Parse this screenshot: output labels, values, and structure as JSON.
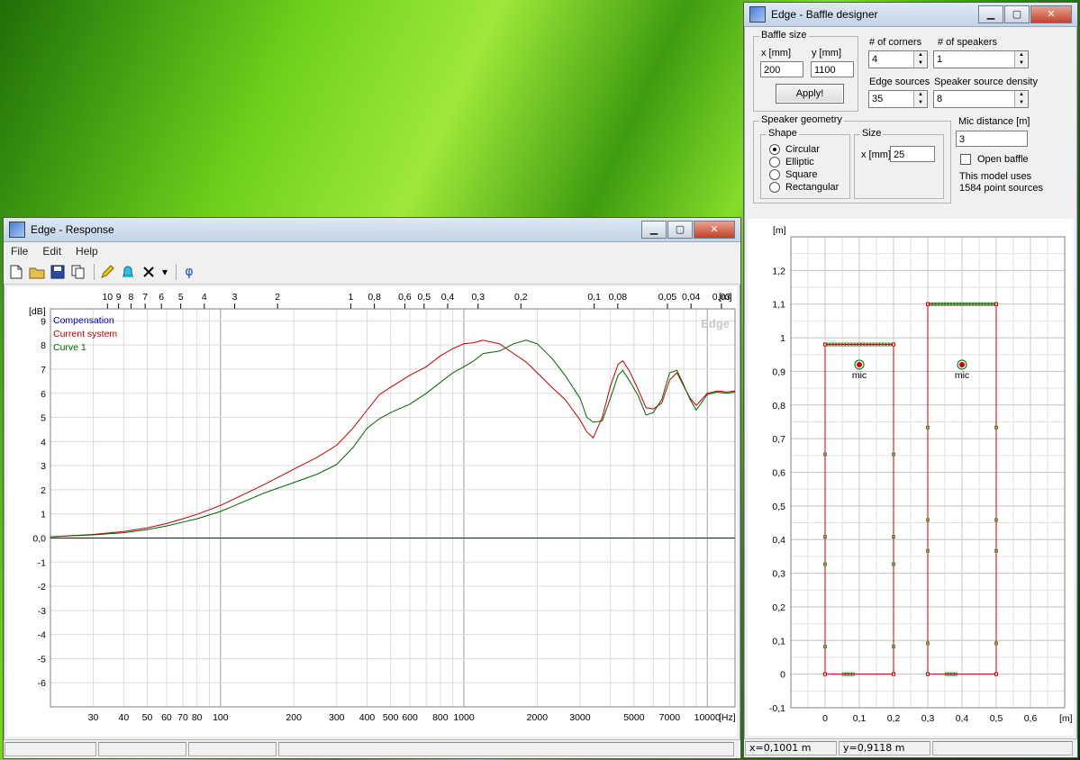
{
  "response_window": {
    "title": "Edge - Response",
    "menu": [
      "File",
      "Edit",
      "Help"
    ],
    "watermark": "Edge",
    "status": [
      "",
      "",
      "",
      ""
    ]
  },
  "baffle_window": {
    "title": "Edge - Baffle designer",
    "baffle_size_label": "Baffle size",
    "x_label": "x [mm]",
    "y_label": "y [mm]",
    "x_value": "200",
    "y_value": "1100",
    "apply_label": "Apply!",
    "corners_label": "# of corners",
    "corners_value": "4",
    "speakers_label": "# of speakers",
    "speakers_value": "1",
    "edge_sources_label": "Edge sources",
    "edge_sources_value": "35",
    "density_label": "Speaker source density",
    "density_value": "8",
    "geometry_label": "Speaker geometry",
    "shape_label": "Shape",
    "shapes": [
      "Circular",
      "Elliptic",
      "Square",
      "Rectangular"
    ],
    "selected_shape": 0,
    "size_label": "Size",
    "size_x_label": "x [mm]",
    "size_x_value": "25",
    "mic_distance_label": "Mic distance [m]",
    "mic_distance_value": "3",
    "open_baffle_label": "Open baffle",
    "model_info_1": "This model uses",
    "model_info_2": "1584 point sources",
    "status_x": "x=0,1001 m",
    "status_y": "y=0,9118 m"
  },
  "chart_data": [
    {
      "type": "line",
      "ylabel": "[dB]",
      "xlabel": "[Hz]",
      "top_axis_label": "[m]",
      "ylim": [
        -7,
        9.5
      ],
      "xlim": [
        20,
        13000
      ],
      "x_scale": "log",
      "grid": true,
      "legend_placement": "top-left",
      "x_ticks": [
        30,
        40,
        50,
        60,
        70,
        80,
        100,
        200,
        300,
        400,
        500,
        600,
        800,
        1000,
        2000,
        3000,
        5000,
        7000,
        10000
      ],
      "x_tick_labels": [
        "30",
        "40",
        "50",
        "60",
        "70",
        "80",
        "100",
        "200",
        "300",
        "400",
        "500",
        "600",
        "800",
        "1000",
        "2000",
        "3000",
        "5000",
        "7000",
        "10000"
      ],
      "top_ticks": [
        10,
        9,
        8,
        7,
        6,
        5,
        4,
        3,
        2,
        1,
        0.8,
        0.6,
        0.5,
        0.4,
        0.3,
        0.2,
        0.1,
        0.08,
        0.05,
        0.04,
        0.03
      ],
      "top_tick_labels": [
        "10",
        "9",
        "8",
        "7",
        "6",
        "5",
        "4",
        "3",
        "2",
        "1",
        "0,8",
        "0,6",
        "0,5",
        "0,4",
        "0,3",
        "0,2",
        "0,1",
        "0,08",
        "0,05",
        "0,04",
        "0,03"
      ],
      "y_ticks": [
        9,
        8,
        7,
        6,
        5,
        4,
        3,
        2,
        1,
        0,
        -1,
        -2,
        -3,
        -4,
        -5,
        -6
      ],
      "y_tick_labels": [
        "9",
        "8",
        "7",
        "6",
        "5",
        "4",
        "3",
        "2",
        "1",
        "0,0",
        "-1",
        "-2",
        "-3",
        "-4",
        "-5",
        "-6"
      ],
      "series": [
        {
          "name": "Compensation",
          "color": "#0000b0",
          "x": [
            20,
            13000
          ],
          "y": [
            0,
            0
          ]
        },
        {
          "name": "Current system",
          "color": "#c00000",
          "x": [
            20,
            30,
            40,
            50,
            60,
            70,
            80,
            100,
            150,
            200,
            250,
            300,
            350,
            400,
            450,
            500,
            600,
            700,
            800,
            900,
            1000,
            1100,
            1200,
            1400,
            1600,
            1800,
            2000,
            2300,
            2600,
            3000,
            3200,
            3400,
            3700,
            4000,
            4300,
            4500,
            4800,
            5200,
            5600,
            6000,
            6500,
            7000,
            7500,
            8000,
            8500,
            9000,
            10000,
            11000,
            12000,
            13000
          ],
          "y": [
            0.05,
            0.15,
            0.27,
            0.42,
            0.6,
            0.8,
            0.98,
            1.35,
            2.2,
            2.85,
            3.35,
            3.85,
            4.55,
            5.3,
            5.95,
            6.25,
            6.75,
            7.1,
            7.55,
            7.85,
            8.05,
            8.1,
            8.2,
            8.05,
            7.65,
            7.3,
            6.85,
            6.25,
            5.75,
            4.9,
            4.4,
            4.15,
            5.0,
            6.3,
            7.2,
            7.35,
            6.9,
            6.15,
            5.4,
            5.35,
            5.6,
            6.55,
            6.85,
            6.3,
            5.8,
            5.5,
            6.0,
            6.1,
            6.05,
            6.1
          ]
        },
        {
          "name": "Curve 1",
          "color": "#006400",
          "x": [
            20,
            30,
            40,
            50,
            60,
            70,
            80,
            100,
            150,
            200,
            250,
            300,
            350,
            400,
            450,
            500,
            600,
            700,
            800,
            900,
            1000,
            1100,
            1200,
            1400,
            1600,
            1800,
            2000,
            2300,
            2600,
            3000,
            3200,
            3400,
            3700,
            4000,
            4300,
            4500,
            4800,
            5200,
            5600,
            6000,
            6500,
            7000,
            7500,
            8000,
            8500,
            9000,
            10000,
            11000,
            12000,
            13000
          ],
          "y": [
            0.05,
            0.13,
            0.22,
            0.35,
            0.5,
            0.66,
            0.8,
            1.1,
            1.85,
            2.3,
            2.65,
            3.05,
            3.75,
            4.55,
            4.95,
            5.2,
            5.55,
            6.0,
            6.45,
            6.85,
            7.1,
            7.35,
            7.65,
            7.75,
            8.05,
            8.2,
            8.05,
            7.45,
            6.75,
            5.8,
            5.0,
            4.8,
            4.85,
            5.8,
            6.75,
            6.95,
            6.5,
            5.9,
            5.1,
            5.2,
            5.75,
            6.85,
            6.95,
            6.35,
            5.75,
            5.3,
            5.95,
            6.05,
            6.0,
            6.05
          ]
        }
      ]
    },
    {
      "type": "scatter",
      "ylabel": "[m]",
      "xlabel": "[m]",
      "xlim": [
        -0.1,
        0.7
      ],
      "ylim": [
        -0.1,
        1.3
      ],
      "grid": true,
      "x_ticks": [
        0,
        0.1,
        0.2,
        0.3,
        0.4,
        0.5,
        0.6
      ],
      "x_tick_labels": [
        "0",
        "0,1",
        "0,2",
        "0,3",
        "0,4",
        "0,5",
        "0,6"
      ],
      "y_ticks": [
        -0.1,
        0,
        0.1,
        0.2,
        0.3,
        0.4,
        0.5,
        0.6,
        0.7,
        0.8,
        0.9,
        1,
        1.1,
        1.2
      ],
      "y_tick_labels": [
        "-0,1",
        "0",
        "0,1",
        "0,2",
        "0,3",
        "0,4",
        "0,5",
        "0,6",
        "0,7",
        "0,8",
        "0,9",
        "1",
        "1,1",
        "1,2"
      ],
      "outline_color": "#cc0000",
      "point_color": "#1a7a1a",
      "mic_label": "mic",
      "baffles": [
        {
          "outline": [
            [
              0,
              0
            ],
            [
              0.2,
              0
            ],
            [
              0.2,
              0.98
            ],
            [
              0,
              0.98
            ]
          ],
          "mic": [
            0.1,
            0.92
          ],
          "speaker": [
            0.1,
            0.92
          ]
        },
        {
          "outline": [
            [
              0.3,
              0
            ],
            [
              0.5,
              0
            ],
            [
              0.5,
              1.1
            ],
            [
              0.3,
              1.1
            ]
          ],
          "mic": [
            0.4,
            0.92
          ],
          "speaker": [
            0.4,
            0.92
          ]
        }
      ]
    }
  ]
}
